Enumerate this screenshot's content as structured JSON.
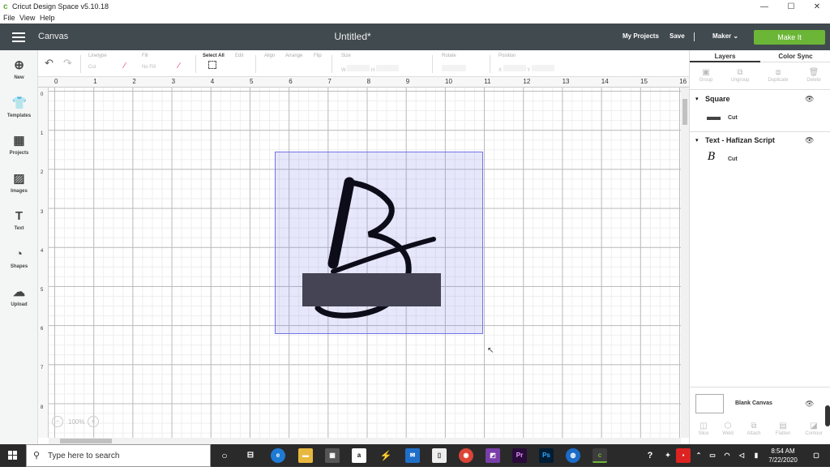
{
  "window": {
    "title": "Cricut Design Space  v5.10.18",
    "min": "—",
    "max": "☐",
    "close": "✕"
  },
  "menu": [
    "File",
    "View",
    "Help"
  ],
  "header": {
    "section": "Canvas",
    "doc_title": "Untitled*",
    "my_projects": "My Projects",
    "save": "Save",
    "machine": "Maker",
    "make_it": "Make It"
  },
  "toolbar": {
    "linetype_label": "Linetype",
    "linetype_value": "Cut",
    "fill_label": "Fill",
    "fill_value": "No Fill",
    "select_all": "Select All",
    "edit": "Edit",
    "align": "Align",
    "arrange": "Arrange",
    "flip": "Flip",
    "size": "Size",
    "size_w": "W",
    "size_h": "H",
    "rotate": "Rotate",
    "position": "Position",
    "pos_x": "X",
    "pos_y": "Y"
  },
  "leftbar": [
    "New",
    "Templates",
    "Projects",
    "Images",
    "Text",
    "Shapes",
    "Upload"
  ],
  "ruler_top": [
    "0",
    "1",
    "2",
    "3",
    "4",
    "5",
    "6",
    "7",
    "8",
    "9",
    "10",
    "11",
    "12",
    "13",
    "14",
    "15",
    "16"
  ],
  "ruler_left": [
    "0",
    "1",
    "2",
    "3",
    "4",
    "5",
    "6",
    "7",
    "8"
  ],
  "zoom": "100%",
  "panel": {
    "tabs": [
      "Layers",
      "Color Sync"
    ],
    "actions_top": [
      "Group",
      "Ungroup",
      "Duplicate",
      "Delete"
    ],
    "layers": [
      {
        "name": "Square",
        "op": "Cut"
      },
      {
        "name": "Text - Hafizan Script",
        "op": "Cut"
      }
    ],
    "blank_canvas": "Blank Canvas",
    "actions_bottom": [
      "Slice",
      "Weld",
      "Attach",
      "Flatten",
      "Contour"
    ]
  },
  "taskbar": {
    "search": "Type here to search",
    "time": "8:54 AM",
    "date": "7/22/2020"
  },
  "colors": {
    "header": "#414a4f",
    "make_it": "#6bb636",
    "selection": "#7373e6",
    "rect": "#444454"
  }
}
